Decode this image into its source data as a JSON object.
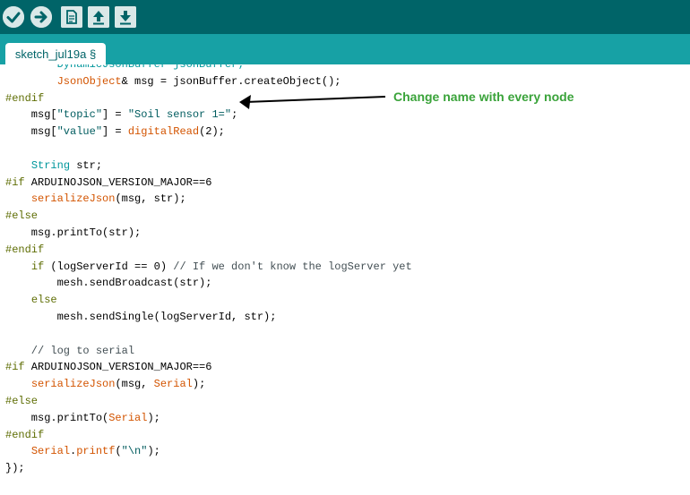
{
  "toolbar": {
    "buttons": [
      {
        "icon": "verify-check-icon"
      },
      {
        "icon": "upload-arrow-icon"
      },
      {
        "icon": "new-sketch-icon"
      },
      {
        "icon": "open-sketch-icon"
      },
      {
        "icon": "save-sketch-icon"
      }
    ],
    "bg_color": "#006468"
  },
  "tab": {
    "label": "sketch_jul19a §"
  },
  "annotation": {
    "text": "Change name with every node",
    "color": "#3aa33a"
  },
  "code": {
    "lines": [
      [
        {
          "t": "        DynamicJsonBuffer jsonBuffer;",
          "c": "ty"
        }
      ],
      [
        {
          "t": "        ",
          "c": ""
        },
        {
          "t": "JsonObject",
          "c": "fn"
        },
        {
          "t": "& msg = jsonBuffer.createObject();",
          "c": ""
        }
      ],
      [
        {
          "t": "#endif",
          "c": "kw"
        }
      ],
      [
        {
          "t": "    msg[",
          "c": ""
        },
        {
          "t": "\"topic\"",
          "c": "str"
        },
        {
          "t": "] = ",
          "c": ""
        },
        {
          "t": "\"Soil sensor 1=\"",
          "c": "str"
        },
        {
          "t": ";",
          "c": ""
        }
      ],
      [
        {
          "t": "    msg[",
          "c": ""
        },
        {
          "t": "\"value\"",
          "c": "str"
        },
        {
          "t": "] = ",
          "c": ""
        },
        {
          "t": "digitalRead",
          "c": "fn"
        },
        {
          "t": "(2);",
          "c": ""
        }
      ],
      [
        {
          "t": "",
          "c": ""
        }
      ],
      [
        {
          "t": "    ",
          "c": ""
        },
        {
          "t": "String",
          "c": "ty"
        },
        {
          "t": " str;",
          "c": ""
        }
      ],
      [
        {
          "t": "#if",
          "c": "kw"
        },
        {
          "t": " ARDUINOJSON_VERSION_MAJOR==6",
          "c": ""
        }
      ],
      [
        {
          "t": "    ",
          "c": ""
        },
        {
          "t": "serializeJson",
          "c": "fn"
        },
        {
          "t": "(msg, str);",
          "c": ""
        }
      ],
      [
        {
          "t": "#else",
          "c": "kw"
        }
      ],
      [
        {
          "t": "    msg.printTo(str);",
          "c": ""
        }
      ],
      [
        {
          "t": "#endif",
          "c": "kw"
        }
      ],
      [
        {
          "t": "    ",
          "c": ""
        },
        {
          "t": "if",
          "c": "kw"
        },
        {
          "t": " (logServerId == 0) ",
          "c": ""
        },
        {
          "t": "// If we don't know the logServer yet",
          "c": "cm"
        }
      ],
      [
        {
          "t": "        mesh.sendBroadcast(str);",
          "c": ""
        }
      ],
      [
        {
          "t": "    ",
          "c": ""
        },
        {
          "t": "else",
          "c": "kw"
        }
      ],
      [
        {
          "t": "        mesh.sendSingle(logServerId, str);",
          "c": ""
        }
      ],
      [
        {
          "t": "",
          "c": ""
        }
      ],
      [
        {
          "t": "    // log to serial",
          "c": "cm"
        }
      ],
      [
        {
          "t": "#if",
          "c": "kw"
        },
        {
          "t": " ARDUINOJSON_VERSION_MAJOR==6",
          "c": ""
        }
      ],
      [
        {
          "t": "    ",
          "c": ""
        },
        {
          "t": "serializeJson",
          "c": "fn"
        },
        {
          "t": "(msg, ",
          "c": ""
        },
        {
          "t": "Serial",
          "c": "fn"
        },
        {
          "t": ");",
          "c": ""
        }
      ],
      [
        {
          "t": "#else",
          "c": "kw"
        }
      ],
      [
        {
          "t": "    msg.printTo(",
          "c": ""
        },
        {
          "t": "Serial",
          "c": "fn"
        },
        {
          "t": ");",
          "c": ""
        }
      ],
      [
        {
          "t": "#endif",
          "c": "kw"
        }
      ],
      [
        {
          "t": "    ",
          "c": ""
        },
        {
          "t": "Serial",
          "c": "fn"
        },
        {
          "t": ".",
          "c": ""
        },
        {
          "t": "printf",
          "c": "fn"
        },
        {
          "t": "(",
          "c": ""
        },
        {
          "t": "\"\\n\"",
          "c": "str"
        },
        {
          "t": ");",
          "c": ""
        }
      ],
      [
        {
          "t": "});",
          "c": ""
        }
      ]
    ]
  }
}
